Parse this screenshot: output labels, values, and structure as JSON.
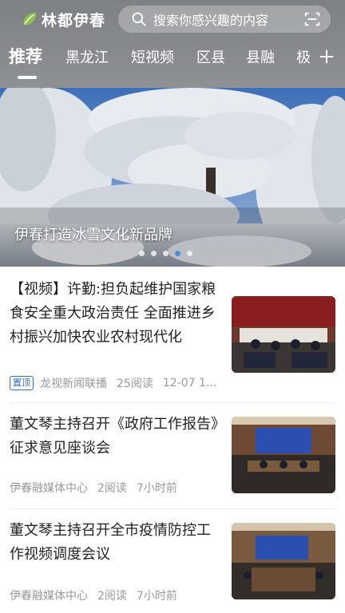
{
  "app": {
    "logo_text": "林都伊春"
  },
  "search": {
    "placeholder": "搜索你感兴趣的内容"
  },
  "tabs": [
    {
      "label": "推荐",
      "active": true
    },
    {
      "label": "黑龙江"
    },
    {
      "label": "短视频"
    },
    {
      "label": "区县"
    },
    {
      "label": "县融"
    },
    {
      "label": "极"
    }
  ],
  "banner": {
    "caption": "伊春打造冰雪文化新品牌",
    "dot_count": 5,
    "active_dot": 3
  },
  "news": [
    {
      "title": "【视频】许勤:担负起维护国家粮食安全重大政治责任 全面推进乡村振兴加快农业农村现代化",
      "badge": "置顶",
      "source": "龙视新闻联播",
      "reads": "25阅读",
      "time": "12-07 1..."
    },
    {
      "title": "董文琴主持召开《政府工作报告》征求意见座谈会",
      "source": "伊春融媒体中心",
      "reads": "2阅读",
      "time": "7小时前"
    },
    {
      "title": "董文琴主持召开全市疫情防控工作视频调度会议",
      "source": "伊春融媒体中心",
      "reads": "2阅读",
      "time": "7小时前"
    }
  ],
  "colors": {
    "accent": "#2a6fd6",
    "header_bg": "#8a8d90",
    "active_dot": "#4a90d9"
  }
}
